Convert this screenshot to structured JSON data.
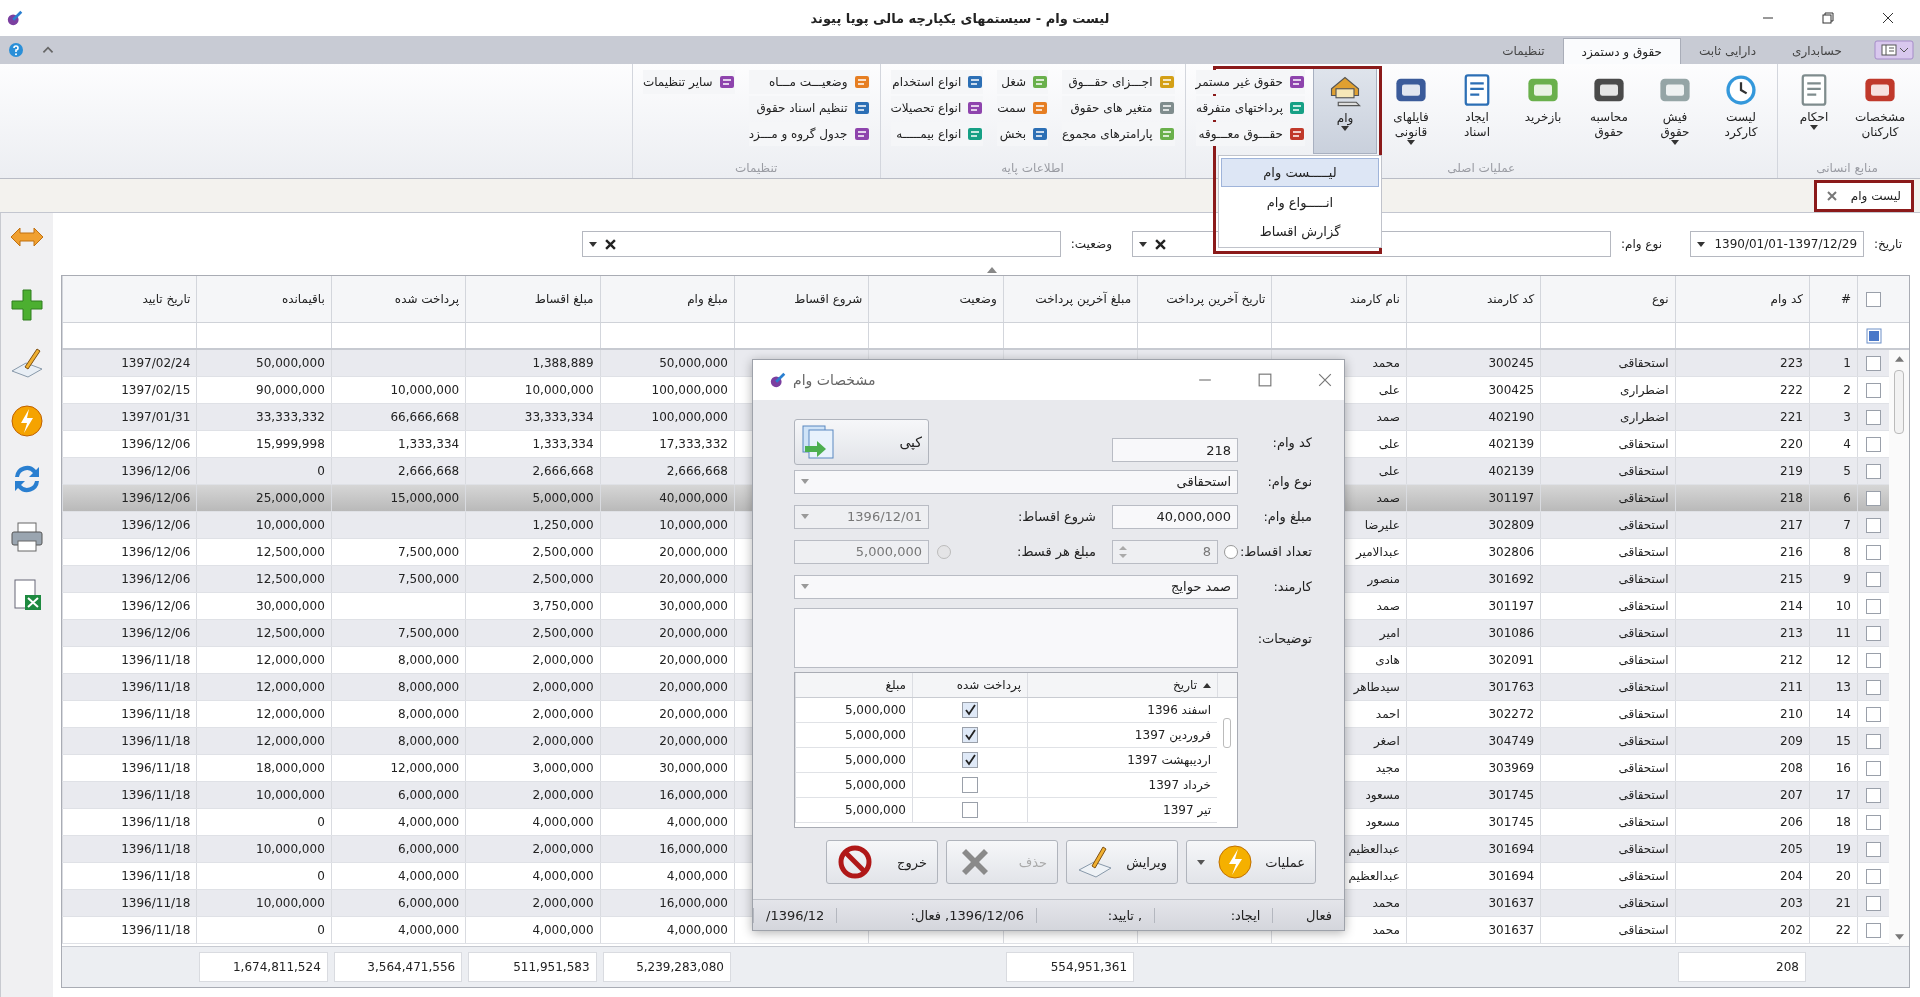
{
  "window": {
    "title": "لیست وام - سیستمهای یکپارچه مالی پویا پیوند"
  },
  "ribbon": {
    "tabs": [
      {
        "label": "حسابداری",
        "selected": false
      },
      {
        "label": "دارایی ثابت",
        "selected": false
      },
      {
        "label": "حقوق و دستمزد",
        "selected": true
      },
      {
        "label": "تنظیمات",
        "selected": false
      }
    ],
    "groups": [
      {
        "label": "منابع انسانی",
        "large": [
          {
            "label": "مشخصات\nکارکنان",
            "dropdown": false,
            "pressed": false
          },
          {
            "label": "احکام",
            "dropdown": true,
            "pressed": false
          }
        ]
      },
      {
        "label": "عملیات اصلی",
        "large": [
          {
            "label": "لیست\nکارکرد",
            "dropdown": false,
            "pressed": false
          },
          {
            "label": "فیش\nحقوق",
            "dropdown": true,
            "pressed": false
          },
          {
            "label": "محاسبه\nحقوق",
            "dropdown": false,
            "pressed": false
          },
          {
            "label": "بازخرید",
            "dropdown": false,
            "pressed": false
          },
          {
            "label": "ایجاد\nاسناد",
            "dropdown": false,
            "pressed": false
          },
          {
            "label": "فایلهای\nقانونی",
            "dropdown": true,
            "pressed": false
          },
          {
            "label": "وام",
            "dropdown": true,
            "pressed": true
          }
        ],
        "small_columns": [
          [
            {
              "label": "حقوق غیر مستمر"
            },
            {
              "label": "پرداختهای متفرقه"
            },
            {
              "label": "حقـــوق معـــوقه"
            }
          ]
        ]
      },
      {
        "label": "اطلاعات پایه",
        "small_columns": [
          [
            {
              "label": "اجـــزای حقـــوق"
            },
            {
              "label": "متغیر های حقوق"
            },
            {
              "label": "پارامترهای مجموع"
            }
          ],
          [
            {
              "label": "شغل"
            },
            {
              "label": "سمت"
            },
            {
              "label": "بخش"
            }
          ],
          [
            {
              "label": "انواع استخدام"
            },
            {
              "label": "انواع تحصیلات"
            },
            {
              "label": "انواع بیمـــــه"
            }
          ]
        ]
      },
      {
        "label": "تنظیمات",
        "small_columns": [
          [
            {
              "label": "وضعیـــت مـــاه"
            },
            {
              "label": "تنظیم اسناد حقوق"
            },
            {
              "label": "جدول گروه و مـــزد"
            }
          ],
          [
            {
              "label": "سایر تنظیمات"
            }
          ]
        ]
      }
    ]
  },
  "loan_menu": {
    "items": [
      {
        "label": "لیـــــست وام",
        "selected": true
      },
      {
        "label": "انـــــواع وام",
        "selected": false
      },
      {
        "label": "گزارش اقساط",
        "selected": false
      }
    ]
  },
  "document_tabs": [
    {
      "label": "لیست وام",
      "selected": true
    }
  ],
  "filters": [
    {
      "label": "تاریخ:",
      "value": "1390/01/01-1397/12/29",
      "kind": "date"
    },
    {
      "label": "نوع وام:",
      "kind": "combo"
    },
    {
      "label": "وضعیت:",
      "kind": "combo"
    }
  ],
  "table": {
    "header_checked": false,
    "columns": [
      "#",
      "کد وام",
      "نوع",
      "کد کارمند",
      "نام کارمند",
      "تاریخ آخرین پرداخت",
      "مبلغ آخرین پرداخت",
      "وضعیت",
      "شروع اقساط",
      "مبلغ وام",
      "مبلغ اقساط",
      "پرداخت شده",
      "باقیمانده",
      "تاریخ تایید"
    ],
    "rows": [
      {
        "selected": false,
        "checked": false,
        "n": "1",
        "loan_code": "223",
        "type": "استحقاقی",
        "emp_code": "300245",
        "name": "محمد",
        "loan_amount": "50,000,000",
        "installment": "1,388,889",
        "remaining": "50,000,000",
        "approve_date": "1397/02/24"
      },
      {
        "selected": false,
        "checked": false,
        "n": "2",
        "loan_code": "222",
        "type": "اضطراری",
        "emp_code": "300425",
        "name": "علی",
        "loan_amount": "100,000,000",
        "installment": "10,000,000",
        "paid": "10,000,000",
        "remaining": "90,000,000",
        "approve_date": "1397/02/15"
      },
      {
        "selected": false,
        "checked": false,
        "n": "3",
        "loan_code": "221",
        "type": "اضطراری",
        "emp_code": "402190",
        "name": "صمد",
        "loan_amount": "100,000,000",
        "installment": "33,333,334",
        "paid": "66,666,668",
        "remaining": "33,333,332",
        "approve_date": "1397/01/31"
      },
      {
        "selected": false,
        "checked": false,
        "n": "4",
        "loan_code": "220",
        "type": "استحقاقی",
        "emp_code": "402139",
        "name": "علی",
        "loan_amount": "17,333,332",
        "installment": "1,333,334",
        "paid": "1,333,334",
        "remaining": "15,999,998",
        "approve_date": "1396/12/06"
      },
      {
        "selected": false,
        "checked": false,
        "n": "5",
        "loan_code": "219",
        "type": "استحقاقی",
        "emp_code": "402139",
        "name": "علی",
        "loan_amount": "2,666,668",
        "installment": "2,666,668",
        "paid": "2,666,668",
        "remaining": "0",
        "approve_date": "1396/12/06"
      },
      {
        "selected": true,
        "checked": false,
        "n": "6",
        "loan_code": "218",
        "type": "استحقاقی",
        "emp_code": "301197",
        "name": "صمد",
        "loan_amount": "40,000,000",
        "installment": "5,000,000",
        "paid": "15,000,000",
        "remaining": "25,000,000",
        "approve_date": "1396/12/06"
      },
      {
        "selected": false,
        "checked": false,
        "n": "7",
        "loan_code": "217",
        "type": "استحقاقی",
        "emp_code": "302809",
        "name": "علیرضا",
        "loan_amount": "10,000,000",
        "installment": "1,250,000",
        "remaining": "10,000,000",
        "approve_date": "1396/12/06"
      },
      {
        "selected": false,
        "checked": false,
        "n": "8",
        "loan_code": "216",
        "type": "استحقاقی",
        "emp_code": "302806",
        "name": "عبدالامیر",
        "loan_amount": "20,000,000",
        "installment": "2,500,000",
        "paid": "7,500,000",
        "remaining": "12,500,000",
        "approve_date": "1396/12/06"
      },
      {
        "selected": false,
        "checked": false,
        "n": "9",
        "loan_code": "215",
        "type": "استحقاقی",
        "emp_code": "301692",
        "name": "منصور",
        "loan_amount": "20,000,000",
        "installment": "2,500,000",
        "paid": "7,500,000",
        "remaining": "12,500,000",
        "approve_date": "1396/12/06"
      },
      {
        "selected": false,
        "checked": false,
        "n": "10",
        "loan_code": "214",
        "type": "استحقاقی",
        "emp_code": "301197",
        "name": "صمد",
        "loan_amount": "30,000,000",
        "installment": "3,750,000",
        "remaining": "30,000,000",
        "approve_date": "1396/12/06"
      },
      {
        "selected": false,
        "checked": false,
        "n": "11",
        "loan_code": "213",
        "type": "استحقاقی",
        "emp_code": "301086",
        "name": "امیر",
        "loan_amount": "20,000,000",
        "installment": "2,500,000",
        "paid": "7,500,000",
        "remaining": "12,500,000",
        "approve_date": "1396/12/06"
      },
      {
        "selected": false,
        "checked": false,
        "n": "12",
        "loan_code": "212",
        "type": "استحقاقی",
        "emp_code": "302091",
        "name": "هادی",
        "loan_amount": "20,000,000",
        "installment": "2,000,000",
        "paid": "8,000,000",
        "remaining": "12,000,000",
        "approve_date": "1396/11/18"
      },
      {
        "selected": false,
        "checked": false,
        "n": "13",
        "loan_code": "211",
        "type": "استحقاقی",
        "emp_code": "301763",
        "name": "سیدطاهر",
        "loan_amount": "20,000,000",
        "installment": "2,000,000",
        "paid": "8,000,000",
        "remaining": "12,000,000",
        "approve_date": "1396/11/18"
      },
      {
        "selected": false,
        "checked": false,
        "n": "14",
        "loan_code": "210",
        "type": "استحقاقی",
        "emp_code": "302272",
        "name": "احمد",
        "loan_amount": "20,000,000",
        "installment": "2,000,000",
        "paid": "8,000,000",
        "remaining": "12,000,000",
        "approve_date": "1396/11/18"
      },
      {
        "selected": false,
        "checked": false,
        "n": "15",
        "loan_code": "209",
        "type": "استحقاقی",
        "emp_code": "304749",
        "name": "اصغر",
        "loan_amount": "20,000,000",
        "installment": "2,000,000",
        "paid": "8,000,000",
        "remaining": "12,000,000",
        "approve_date": "1396/11/18"
      },
      {
        "selected": false,
        "checked": false,
        "n": "16",
        "loan_code": "208",
        "type": "استحقاقی",
        "emp_code": "303969",
        "name": "مجید",
        "loan_amount": "30,000,000",
        "installment": "3,000,000",
        "paid": "12,000,000",
        "remaining": "18,000,000",
        "approve_date": "1396/11/18"
      },
      {
        "selected": false,
        "checked": false,
        "n": "17",
        "loan_code": "207",
        "type": "استحقاقی",
        "emp_code": "301745",
        "name": "مسعود",
        "loan_amount": "16,000,000",
        "installment": "2,000,000",
        "paid": "6,000,000",
        "remaining": "10,000,000",
        "approve_date": "1396/11/18"
      },
      {
        "selected": false,
        "checked": false,
        "n": "18",
        "loan_code": "206",
        "type": "استحقاقی",
        "emp_code": "301745",
        "name": "مسعود",
        "loan_amount": "4,000,000",
        "installment": "4,000,000",
        "paid": "4,000,000",
        "remaining": "0",
        "approve_date": "1396/11/18"
      },
      {
        "selected": false,
        "checked": false,
        "n": "19",
        "loan_code": "205",
        "type": "استحقاقی",
        "emp_code": "301694",
        "name": "عبدالعظیم",
        "loan_amount": "16,000,000",
        "installment": "2,000,000",
        "paid": "6,000,000",
        "remaining": "10,000,000",
        "approve_date": "1396/11/18"
      },
      {
        "selected": false,
        "checked": false,
        "n": "20",
        "loan_code": "204",
        "type": "استحقاقی",
        "emp_code": "301694",
        "name": "عبدالعظیم",
        "loan_amount": "4,000,000",
        "installment": "4,000,000",
        "paid": "4,000,000",
        "remaining": "0",
        "approve_date": "1396/11/18"
      },
      {
        "selected": false,
        "checked": false,
        "n": "21",
        "loan_code": "203",
        "type": "استحقاقی",
        "emp_code": "301637",
        "name": "محمد",
        "loan_amount": "16,000,000",
        "installment": "2,000,000",
        "paid": "6,000,000",
        "remaining": "10,000,000",
        "approve_date": "1396/11/18"
      },
      {
        "selected": false,
        "checked": false,
        "n": "22",
        "loan_code": "202",
        "type": "استحقاقی",
        "emp_code": "301637",
        "name": "محمد",
        "loan_amount": "4,000,000",
        "installment": "4,000,000",
        "paid": "4,000,000",
        "remaining": "0",
        "approve_date": "1396/11/18"
      }
    ],
    "totals": {
      "loan_code": "208",
      "last_amount": "554,951,361",
      "loan_amount": "5,239,283,080",
      "installment": "511,951,583",
      "paid": "3,564,471,556",
      "remaining": "1,674,811,524"
    }
  },
  "dialog": {
    "title": "مشخصات وام",
    "copy_button": "کپی",
    "fields": {
      "loan_code": {
        "label": "کد وام:",
        "value": "218"
      },
      "loan_type": {
        "label": "نوع وام:",
        "value": "استحقاقی"
      },
      "amount": {
        "label": "مبلغ وام:",
        "value": "40,000,000"
      },
      "start": {
        "label": "شروع اقساط:",
        "value": "1396/12/01",
        "disabled": true
      },
      "count": {
        "label": "تعداد اقساط:",
        "value": "8",
        "disabled": true,
        "radio_selected": false,
        "radio_disabled": false
      },
      "per": {
        "label": "مبلغ هر قسط:",
        "value": "5,000,000",
        "disabled": true,
        "radio_selected": false,
        "radio_disabled": true
      },
      "employee": {
        "label": "کارمند:",
        "value": "صمد حوایج"
      },
      "notes": {
        "label": "توضیحات:"
      }
    },
    "installments": {
      "columns": [
        {
          "label": "تاریخ",
          "sorted": true
        },
        {
          "label": "پرداخت شده",
          "sorted": false
        },
        {
          "label": "مبلغ",
          "sorted": false
        }
      ],
      "rows": [
        {
          "date": "اسفند 1396",
          "paid": true,
          "amount": "5,000,000"
        },
        {
          "date": "فروردین 1397",
          "paid": true,
          "amount": "5,000,000"
        },
        {
          "date": "اردیبهشت 1397",
          "paid": true,
          "amount": "5,000,000"
        },
        {
          "date": "خرداد 1397",
          "paid": false,
          "amount": "5,000,000"
        },
        {
          "date": "تیر 1397",
          "paid": false,
          "amount": "5,000,000"
        }
      ]
    },
    "buttons": [
      {
        "label": "عملیات",
        "disabled": false,
        "dropdown": true
      },
      {
        "label": "ویرایش",
        "disabled": false,
        "dropdown": false
      },
      {
        "label": "حذف",
        "disabled": true,
        "dropdown": false
      },
      {
        "label": "خروج",
        "disabled": false,
        "dropdown": false
      }
    ],
    "status": [
      "فعال",
      "ایجاد:",
      ", تایید:",
      "1396/12/06, فعال:",
      "1396/12/"
    ]
  }
}
